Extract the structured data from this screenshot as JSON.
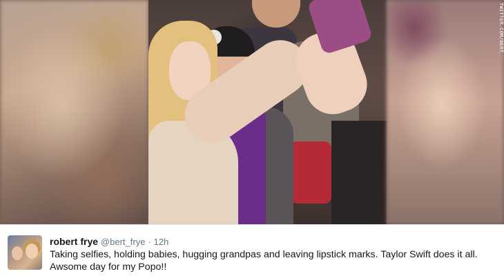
{
  "photo": {
    "credit": "TWITTER.COM/BERT_FR"
  },
  "tweet": {
    "author_name": "robert frye",
    "author_handle": "@bert_frye",
    "separator": "·",
    "time": "12h",
    "text_line1": "Taking selfies, holding babies, hugging grandpas and leaving lipstick marks. Taylor Swift does it all.",
    "text_line2": "Awsome day for my Popo!!"
  },
  "colors": {
    "name": "#14171a",
    "meta": "#657786",
    "border": "#e1e8ed"
  }
}
